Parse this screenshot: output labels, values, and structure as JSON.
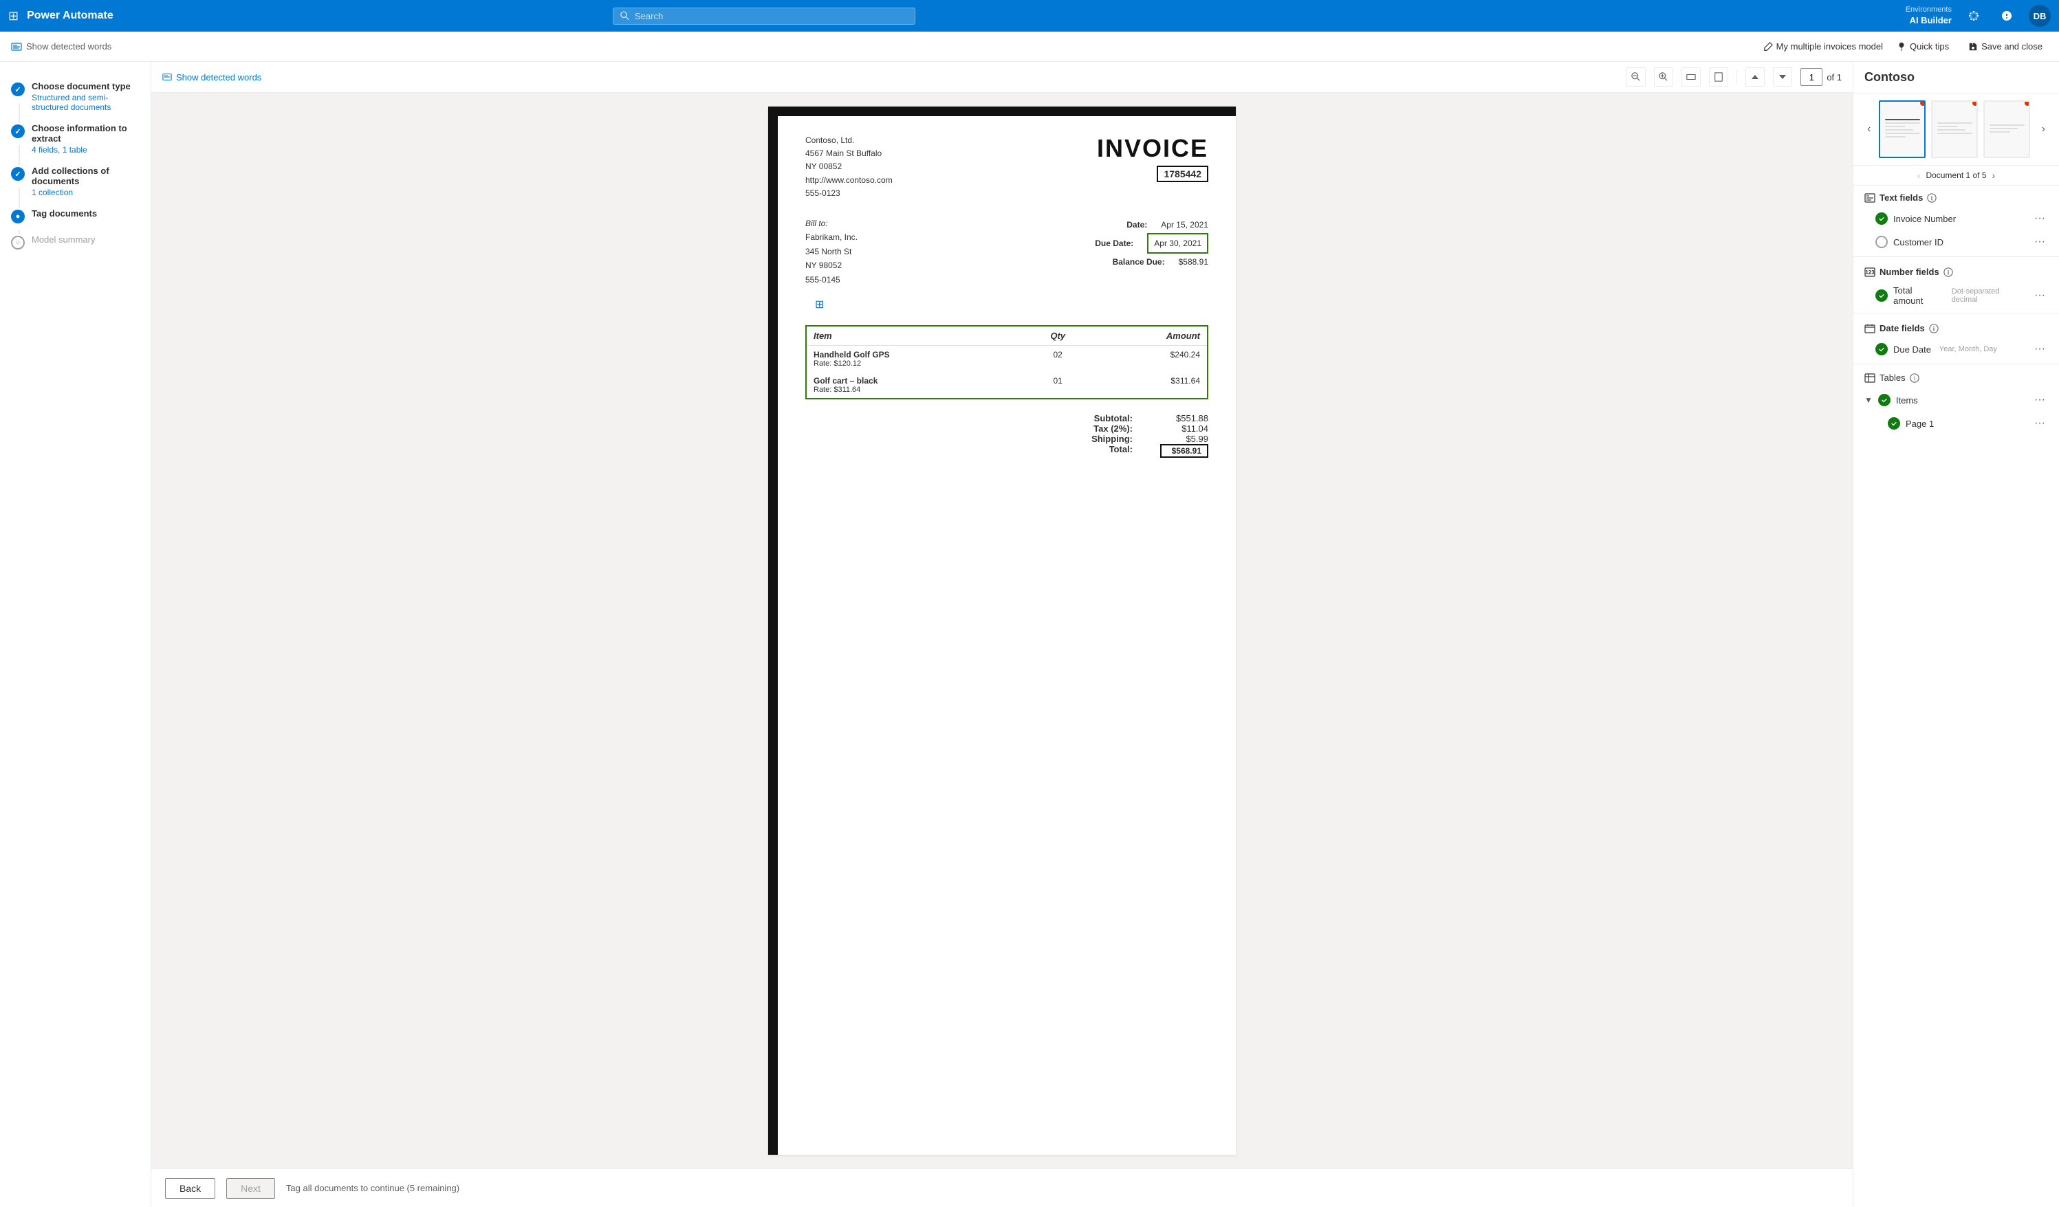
{
  "app": {
    "name": "Power Automate",
    "waffle": "⊞"
  },
  "search": {
    "placeholder": "Search"
  },
  "environment": {
    "label": "Environments",
    "name": "AI Builder"
  },
  "topnav": {
    "avatar_initials": "DB"
  },
  "subnav": {
    "show_words": "Show detected words",
    "model_link": "My multiple invoices model",
    "quick_tips": "Quick tips",
    "save_close": "Save and close"
  },
  "steps": [
    {
      "id": 1,
      "title": "Choose document type",
      "subtitle": "Structured and semi-structured documents",
      "status": "completed"
    },
    {
      "id": 2,
      "title": "Choose information to extract",
      "subtitle": "4 fields, 1 table",
      "status": "completed"
    },
    {
      "id": 3,
      "title": "Add collections of documents",
      "subtitle": "1 collection",
      "status": "active"
    },
    {
      "id": 4,
      "title": "Tag documents",
      "subtitle": "",
      "status": "active_current"
    },
    {
      "id": 5,
      "title": "Model summary",
      "subtitle": "",
      "status": "inactive"
    }
  ],
  "toolbar": {
    "zoom_in": "+",
    "zoom_out": "−",
    "fit_width": "↔",
    "fit_page": "⛶",
    "nav_up": "↑",
    "nav_down": "↓",
    "page_current": "1",
    "page_total": "of 1"
  },
  "invoice": {
    "company_name": "Contoso, Ltd.",
    "address_line1": "4567 Main St Buffalo",
    "address_line2": "NY 00852",
    "website": "http://www.contoso.com",
    "phone": "555-0123",
    "title": "INVOICE",
    "number": "1785442",
    "bill_to_label": "Bill to:",
    "customer_name": "Fabrikam, Inc.",
    "customer_addr1": "345 North St",
    "customer_addr2": "NY 98052",
    "customer_phone": "555-0145",
    "date_label": "Date:",
    "date_value": "Apr 15, 2021",
    "due_date_label": "Due Date:",
    "due_date_value": "Apr 30, 2021",
    "balance_label": "Balance Due:",
    "balance_value": "$588.91",
    "items_header_item": "Item",
    "items_header_qty": "Qty",
    "items_header_amount": "Amount",
    "items": [
      {
        "name": "Handheld Golf GPS",
        "rate": "Rate: $120.12",
        "qty": "02",
        "amount": "$240.24"
      },
      {
        "name": "Golf cart – black",
        "rate": "Rate: $311.64",
        "qty": "01",
        "amount": "$311.64"
      }
    ],
    "subtotal_label": "Subtotal:",
    "subtotal_value": "$551.88",
    "tax_label": "Tax (2%):",
    "tax_value": "$11.04",
    "shipping_label": "Shipping:",
    "shipping_value": "$5.99",
    "total_label": "Total:",
    "total_value": "$568.91"
  },
  "bottom_bar": {
    "back_label": "Back",
    "next_label": "Next",
    "status": "Tag all documents to continue (5 remaining)"
  },
  "right_panel": {
    "title": "Contoso",
    "doc_nav": "Document 1 of 5",
    "text_fields_label": "Text fields",
    "number_fields_label": "Number fields",
    "date_fields_label": "Date fields",
    "tables_label": "Tables",
    "fields": {
      "text": [
        {
          "name": "Invoice Number",
          "checked": true,
          "hint": ""
        },
        {
          "name": "Customer ID",
          "checked": false,
          "hint": ""
        }
      ],
      "number": [
        {
          "name": "Total amount",
          "checked": true,
          "hint": "Dot-separated decimal"
        }
      ],
      "date": [
        {
          "name": "Due Date",
          "checked": true,
          "hint": "Year, Month, Day"
        }
      ],
      "tables": [
        {
          "name": "Items",
          "checked": true,
          "expanded": true,
          "sub_items": [
            {
              "name": "Page 1",
              "checked": true
            }
          ]
        }
      ]
    }
  }
}
